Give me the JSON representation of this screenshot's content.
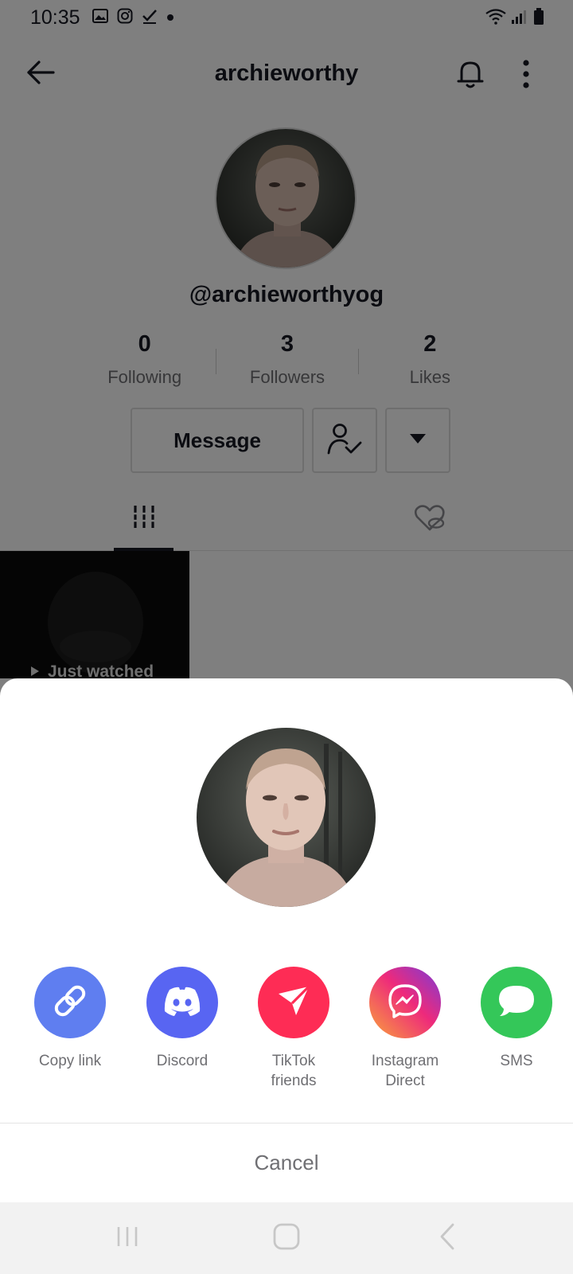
{
  "status_bar": {
    "time": "10:35",
    "left_icons": [
      "gallery-icon",
      "instagram-icon",
      "checkmark-icon",
      "dot-icon"
    ],
    "right_icons": [
      "wifi-icon",
      "signal-icon",
      "battery-icon"
    ]
  },
  "header": {
    "title": "archieworthy",
    "back_icon": "back-arrow-icon",
    "bell_icon": "bell-icon",
    "more_icon": "more-vertical-icon"
  },
  "profile": {
    "username": "@archieworthyog",
    "stats": [
      {
        "value": "0",
        "label": "Following"
      },
      {
        "value": "3",
        "label": "Followers"
      },
      {
        "value": "2",
        "label": "Likes"
      }
    ],
    "message_label": "Message",
    "tabs": [
      "videos-grid-icon",
      "liked-hidden-icon"
    ],
    "thumbnail_label": "Just watched"
  },
  "share_sheet": {
    "items": [
      {
        "label": "Copy link",
        "icon": "link-icon",
        "color": "#5f7ef0"
      },
      {
        "label": "Discord",
        "icon": "discord-icon",
        "color": "#5865f2"
      },
      {
        "label": "TikTok\nfriends",
        "icon": "send-icon",
        "color": "#fe2c55"
      },
      {
        "label": "Instagram\nDirect",
        "icon": "messenger-icon",
        "color": "#c13584"
      },
      {
        "label": "SMS",
        "icon": "message-bubble-icon",
        "color": "#34c759"
      }
    ],
    "cancel_label": "Cancel"
  },
  "nav_bar": {
    "icons": [
      "recents-icon",
      "home-icon",
      "back-icon"
    ]
  }
}
